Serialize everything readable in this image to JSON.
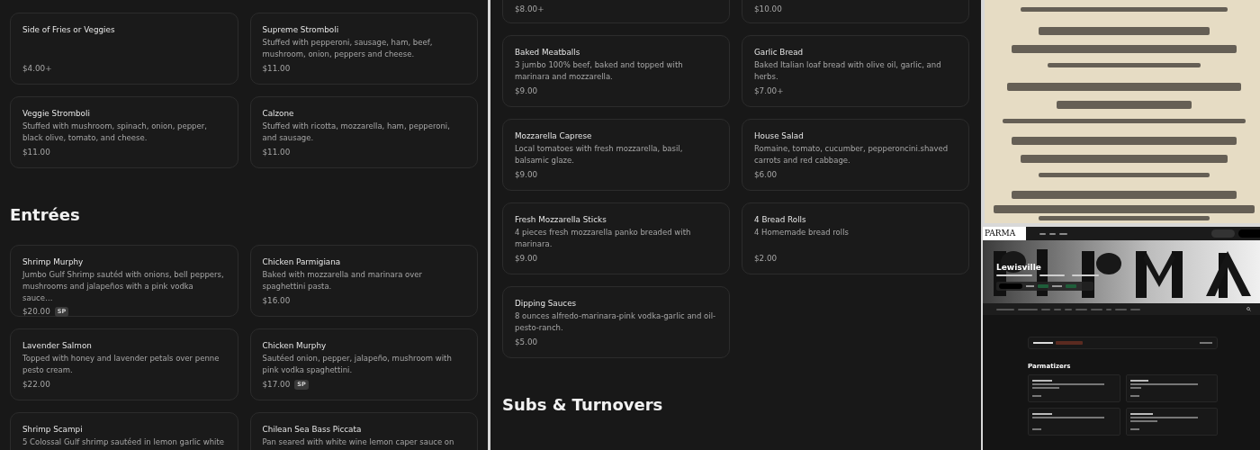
{
  "panels": [
    {
      "sections": [
        {
          "items": [
            {
              "name": "Side of Fries or Veggies",
              "price": "$4.00+"
            },
            {
              "name": "Supreme Stromboli",
              "description": "Stuffed with pepperoni, sausage, ham, beef, mushroom, onion, peppers and cheese.",
              "price": "$11.00"
            },
            {
              "name": "Veggie Stromboli",
              "description": "Stuffed with mushroom, spinach, onion, pepper, black olive, tomato, and cheese.",
              "price": "$11.00"
            },
            {
              "name": "Calzone",
              "description": "Stuffed with ricotta, mozzarella, ham, pepperoni, and sausage.",
              "price": "$11.00"
            }
          ]
        },
        {
          "heading": "Entrées",
          "items": [
            {
              "name": "Shrimp Murphy",
              "description": "Jumbo Gulf Shrimp sautéd with onions, bell peppers, mushrooms and jalapeños with a pink vodka sauce…",
              "price": "$20.00",
              "tags": [
                "SP"
              ]
            },
            {
              "name": "Chicken Parmigiana",
              "description": "Baked with mozzarella and marinara over spaghettini pasta.",
              "price": "$16.00"
            },
            {
              "name": "Lavender Salmon",
              "description": "Topped with honey and lavender petals over penne pesto cream.",
              "price": "$22.00"
            },
            {
              "name": "Chicken Murphy",
              "description": "Sautéed onion, pepper, jalapeño, mushroom with pink vodka spaghettini.",
              "price": "$17.00",
              "tags": [
                "SP"
              ]
            },
            {
              "name": "Shrimp Scampi",
              "description": "5 Colossal Gulf shrimp sautéed in lemon garlic white"
            },
            {
              "name": "Chilean Sea Bass Piccata",
              "description": "Pan seared with white wine lemon caper sauce on"
            }
          ]
        }
      ]
    },
    {
      "sections": [
        {
          "items": [
            {
              "price": "$8.00+"
            },
            {
              "price": "$10.00"
            },
            {
              "name": "Baked Meatballs",
              "description": "3 jumbo 100% beef, baked and topped with marinara and mozzarella.",
              "price": "$9.00"
            },
            {
              "name": "Garlic Bread",
              "description": "Baked Italian loaf bread with olive oil, garlic, and herbs.",
              "price": "$7.00+"
            },
            {
              "name": "Mozzarella Caprese",
              "description": "Local tomatoes with fresh mozzarella, basil, balsamic glaze.",
              "price": "$9.00"
            },
            {
              "name": "House Salad",
              "description": "Romaine, tomato, cucumber, pepperoncini.shaved carrots and red cabbage.",
              "price": "$6.00"
            },
            {
              "name": "Fresh Mozzarella Sticks",
              "description": "4 pieces fresh mozzarella panko breaded with marinara.",
              "price": "$9.00"
            },
            {
              "name": "4 Bread Rolls",
              "description": "4 Homemade bread rolls",
              "price": "$2.00"
            },
            {
              "name": "Dipping Sauces",
              "description": "8 ounces alfredo-marinara-pink vodka-garlic and oil-pesto-ranch.",
              "price": "$5.00"
            }
          ]
        },
        {
          "heading": "Subs & Turnovers"
        }
      ]
    }
  ],
  "site": {
    "logo": "PARMA",
    "location": "Lewisville",
    "section": "Parmatizers"
  }
}
